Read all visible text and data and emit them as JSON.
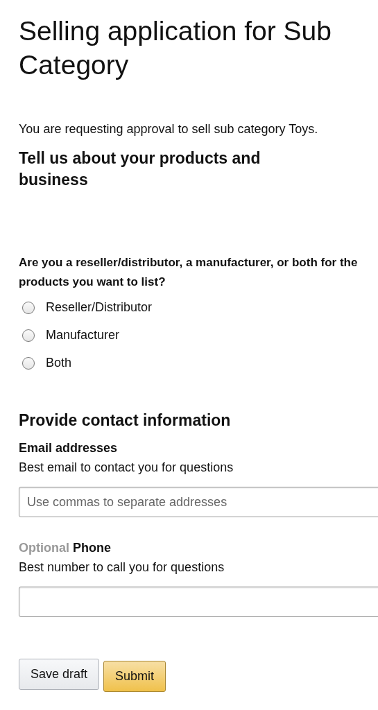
{
  "title": "Selling application for Sub Category",
  "intro": "You are requesting approval to sell sub category Toys.",
  "section_heading": "Tell us about your products and business",
  "question": {
    "label": "Are you a reseller/distributor, a manufacturer, or both for the products you want to list?",
    "options": [
      {
        "label": "Reseller/Distributor",
        "selected": false
      },
      {
        "label": "Manufacturer",
        "selected": false
      },
      {
        "label": "Both",
        "selected": false
      }
    ]
  },
  "contact_heading": "Provide contact information",
  "email": {
    "label": "Email addresses",
    "hint": "Best email to contact you for questions",
    "placeholder": "Use commas to separate addresses"
  },
  "phone": {
    "optional_tag": "Optional",
    "label": "Phone",
    "hint": "Best number to call you for questions"
  },
  "buttons": [
    {
      "label": "Save draft",
      "kind": "secondary"
    },
    {
      "label": "Submit",
      "kind": "primary"
    }
  ]
}
